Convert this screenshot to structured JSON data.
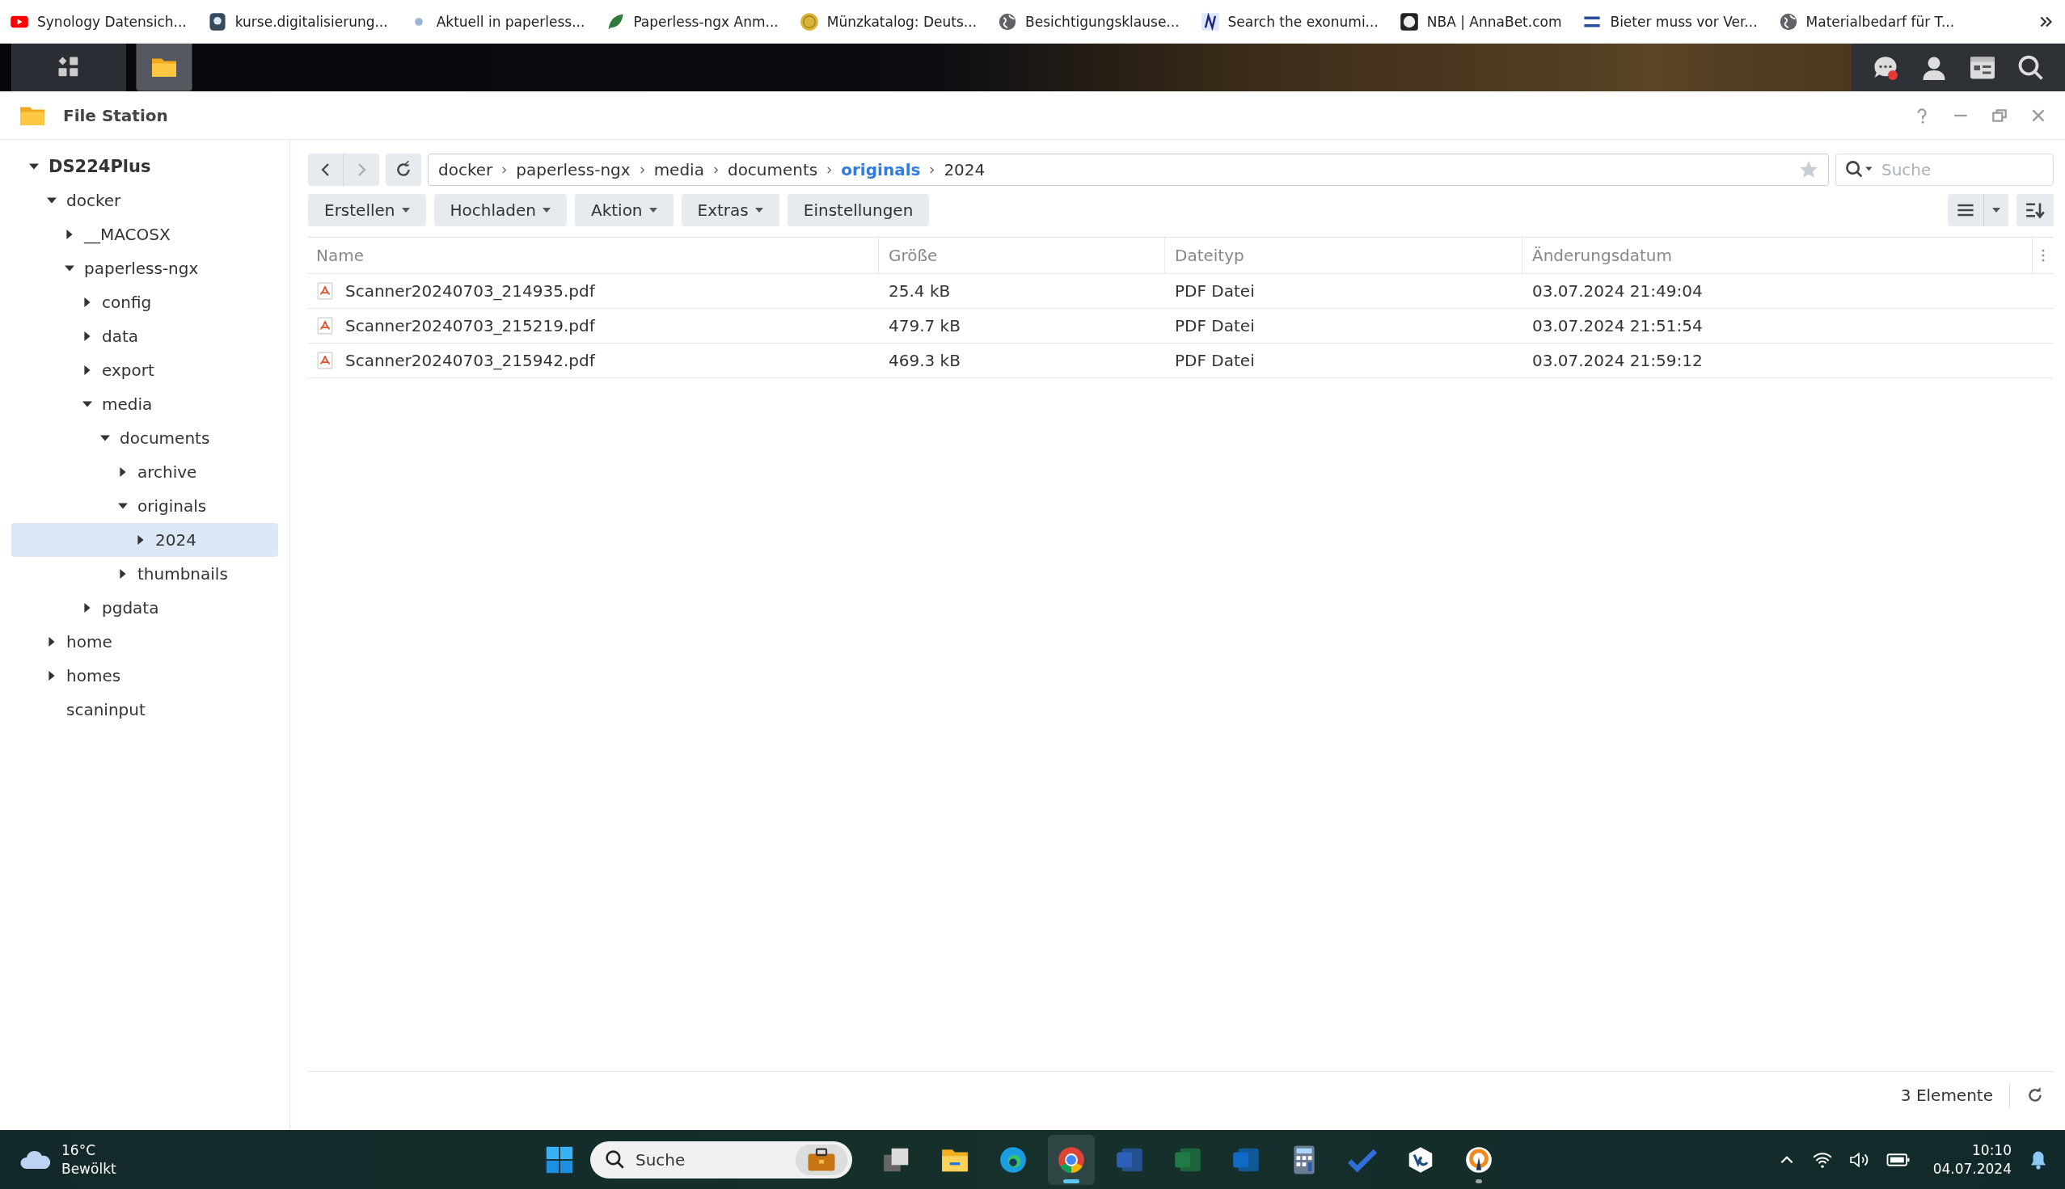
{
  "bookmarks": [
    {
      "kind": "youtube",
      "title": "Synology Datensich..."
    },
    {
      "kind": "shield",
      "title": "kurse.digitalisierung..."
    },
    {
      "kind": "sparkle",
      "title": "Aktuell in paperless..."
    },
    {
      "kind": "leaf",
      "title": "Paperless-ngx Anm..."
    },
    {
      "kind": "coin",
      "title": "Münzkatalog: Deuts..."
    },
    {
      "kind": "globe",
      "title": "Besichtigungsklause..."
    },
    {
      "kind": "letter",
      "title": "Search the exonumi..."
    },
    {
      "kind": "ball",
      "title": "NBA | AnnaBet.com"
    },
    {
      "kind": "bsz",
      "title": "Bieter muss vor Ver..."
    },
    {
      "kind": "globe",
      "title": "Materialbedarf für T..."
    }
  ],
  "window": {
    "title": "File Station"
  },
  "tree": [
    {
      "label": "DS224Plus",
      "expandable": true,
      "expanded": true,
      "selected": false,
      "children": [
        {
          "label": "docker",
          "expandable": true,
          "expanded": true,
          "selected": false,
          "children": [
            {
              "label": "__MACOSX",
              "expandable": true,
              "expanded": false,
              "selected": false
            },
            {
              "label": "paperless-ngx",
              "expandable": true,
              "expanded": true,
              "selected": false,
              "children": [
                {
                  "label": "config",
                  "expandable": true,
                  "expanded": false,
                  "selected": false
                },
                {
                  "label": "data",
                  "expandable": true,
                  "expanded": false,
                  "selected": false
                },
                {
                  "label": "export",
                  "expandable": true,
                  "expanded": false,
                  "selected": false
                },
                {
                  "label": "media",
                  "expandable": true,
                  "expanded": true,
                  "selected": false,
                  "children": [
                    {
                      "label": "documents",
                      "expandable": true,
                      "expanded": true,
                      "selected": false,
                      "children": [
                        {
                          "label": "archive",
                          "expandable": true,
                          "expanded": false,
                          "selected": false
                        },
                        {
                          "label": "originals",
                          "expandable": true,
                          "expanded": true,
                          "selected": false,
                          "children": [
                            {
                              "label": "2024",
                              "expandable": true,
                              "expanded": false,
                              "selected": true
                            }
                          ]
                        },
                        {
                          "label": "thumbnails",
                          "expandable": true,
                          "expanded": false,
                          "selected": false
                        }
                      ]
                    }
                  ]
                },
                {
                  "label": "pgdata",
                  "expandable": true,
                  "expanded": false,
                  "selected": false
                }
              ]
            }
          ]
        },
        {
          "label": "home",
          "expandable": true,
          "expanded": false,
          "selected": false
        },
        {
          "label": "homes",
          "expandable": true,
          "expanded": false,
          "selected": false
        },
        {
          "label": "scaninput",
          "expandable": false,
          "expanded": false,
          "selected": false
        }
      ]
    }
  ],
  "breadcrumb": [
    {
      "label": "docker",
      "highlighted": false
    },
    {
      "label": "paperless-ngx",
      "highlighted": false
    },
    {
      "label": "media",
      "highlighted": false
    },
    {
      "label": "documents",
      "highlighted": false
    },
    {
      "label": "originals",
      "highlighted": true
    },
    {
      "label": "2024",
      "highlighted": false
    }
  ],
  "search": {
    "placeholder": "Suche"
  },
  "toolbar": [
    {
      "label": "Erstellen",
      "dropdown": true
    },
    {
      "label": "Hochladen",
      "dropdown": true
    },
    {
      "label": "Aktion",
      "dropdown": true
    },
    {
      "label": "Extras",
      "dropdown": true
    },
    {
      "label": "Einstellungen",
      "dropdown": false
    }
  ],
  "table": {
    "columns": [
      "Name",
      "Größe",
      "Dateityp",
      "Änderungsdatum"
    ],
    "rows": [
      {
        "name": "Scanner20240703_214935.pdf",
        "size": "25.4 kB",
        "type": "PDF Datei",
        "modified": "03.07.2024 21:49:04",
        "selected": false
      },
      {
        "name": "Scanner20240703_215219.pdf",
        "size": "479.7 kB",
        "type": "PDF Datei",
        "modified": "03.07.2024 21:51:54",
        "selected": false
      },
      {
        "name": "Scanner20240703_215942.pdf",
        "size": "469.3 kB",
        "type": "PDF Datei",
        "modified": "03.07.2024 21:59:12",
        "selected": false
      }
    ]
  },
  "status_bar": {
    "count": "3 Elemente"
  },
  "taskbar": {
    "weather": {
      "temperature": "16°C",
      "condition": "Bewölkt"
    },
    "search": {
      "placeholder": "Suche"
    },
    "apps": [
      {
        "kind": "task-view",
        "running": false,
        "active": false
      },
      {
        "kind": "files",
        "running": false,
        "active": false
      },
      {
        "kind": "edge",
        "running": false,
        "active": false
      },
      {
        "kind": "chrome",
        "running": true,
        "active": true
      },
      {
        "kind": "word",
        "running": false,
        "active": false
      },
      {
        "kind": "excel",
        "running": false,
        "active": false
      },
      {
        "kind": "outlook",
        "running": false,
        "active": false
      },
      {
        "kind": "calculator",
        "running": false,
        "active": false
      },
      {
        "kind": "todo",
        "running": false,
        "active": false
      },
      {
        "kind": "veracrypt",
        "running": false,
        "active": false
      },
      {
        "kind": "vpn",
        "running": true,
        "active": false
      }
    ],
    "time": "10:10",
    "date": "04.07.2024"
  }
}
